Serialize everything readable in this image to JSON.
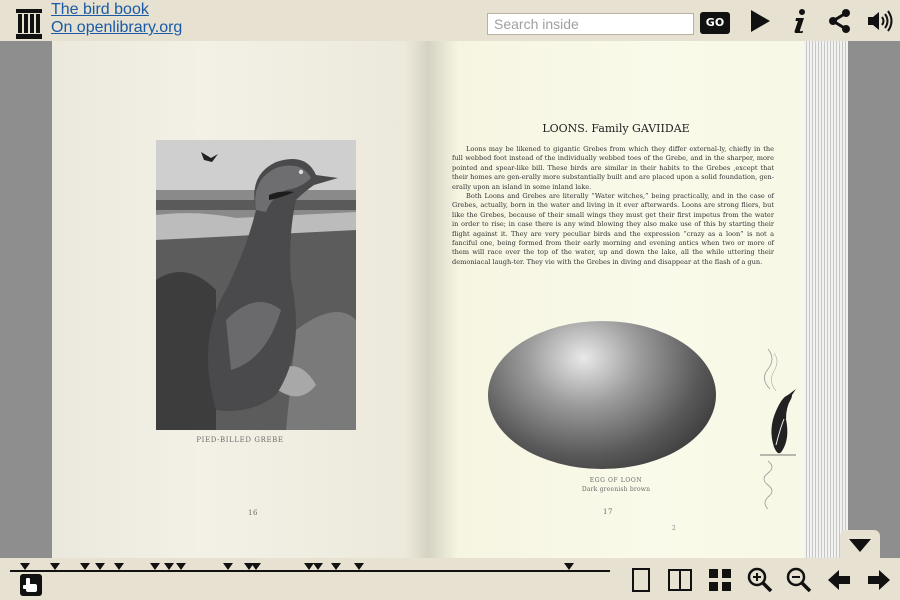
{
  "header": {
    "archive_label": "INTERNET ARCHIVE",
    "title_link": "The bird book",
    "openlibrary_link": "On openlibrary.org"
  },
  "search": {
    "placeholder": "Search inside",
    "go_label": "GO"
  },
  "toolbar_icons": [
    "play-icon",
    "info-icon",
    "share-icon",
    "audio-icon"
  ],
  "left_page": {
    "plate_caption": "PIED-BILLED GREBE",
    "page_number": "16"
  },
  "right_page": {
    "chapter_title": "LOONS.   Family GAVIIDAE",
    "paragraphs": [
      "Loons may be likened to gigantic Grebes from which they differ external-ly, chiefly in the full webbed foot instead of the individually webbed toes of the Grebe, and in the sharper, more pointed and spear-like bill. These birds are similar in their habits to the Grebes ,except that their homes are gen-erally more substantially built and are placed upon a solid foundation, gen-erally upon an island in some inland lake.",
      "Both Loons and Grebes are literally “Water witches,” being practically, and in the case of Grebes, actually, born in the water and living in it ever afterwards. Loons are strong fliers, but like the Grebes, because of their small wings they must get their first impetus from the water in order to rise; in case there is any wind blowing they also make use of this by starting their flight against it. They are very peculiar birds and the expression “crazy as a loon” is not a fanciful one, being formed from their early morning and evening antics when two or more of them will race over the top of the water, up and down the lake, all the while uttering their demoniacal laugh-ter. They vie with the Grebes in diving and disappear at the flash of a gun."
    ],
    "egg_caption": "EGG OF LOON",
    "egg_subcaption": "Dark greenish brown",
    "page_number": "17",
    "plate_number": "2"
  },
  "bottom_icons": [
    "one-page-icon",
    "two-page-icon",
    "thumbnails-icon",
    "zoom-in-icon",
    "zoom-out-icon",
    "previous-page-icon",
    "next-page-icon"
  ],
  "navigation": {
    "marker_count": 22
  }
}
